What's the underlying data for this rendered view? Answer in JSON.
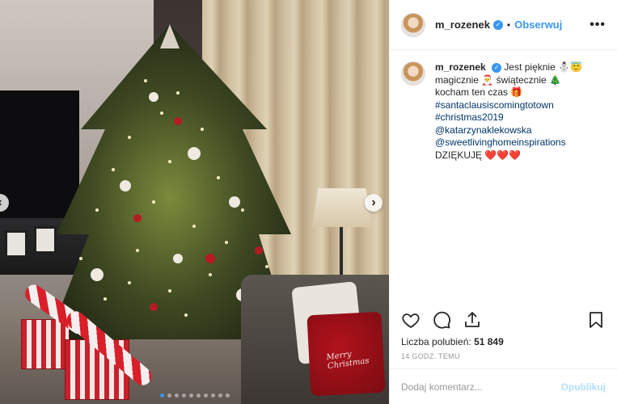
{
  "post": {
    "username": "m_rozenek",
    "follow_label": "Obserwuj",
    "separator": "•",
    "more_label": "•••"
  },
  "caption": {
    "username": "m_rozenek",
    "line1": "Jest pięknie ⛄😇",
    "line2": "magicznie 🎅 świątecznie 🎄",
    "line3": "kocham ten czas 🎁",
    "hashtag1": "#santaclausiscomingtotown",
    "hashtag2": "#christmas2019",
    "mention1": "@katarzynaklekowska",
    "mention2": "@sweetlivinghomeinspirations",
    "thanks": "DZIĘKUJĘ ❤️❤️❤️"
  },
  "likes": {
    "label": "Liczba polubień:",
    "count": "51 849"
  },
  "timestamp": "14 GODZ. TEMU",
  "comment": {
    "placeholder": "Dodaj komentarz...",
    "post_label": "Opublikuj"
  },
  "carousel": {
    "total": 10,
    "active": 0
  },
  "photo": {
    "pillow_text": "Merry Christmas"
  },
  "colors": {
    "accent": "#3897f0",
    "link": "#003569",
    "post_disabled": "#b2dffc"
  },
  "icons": [
    "heart-icon",
    "comment-icon",
    "share-icon",
    "bookmark-icon",
    "chevron-left-icon",
    "chevron-right-icon",
    "verified-icon"
  ]
}
